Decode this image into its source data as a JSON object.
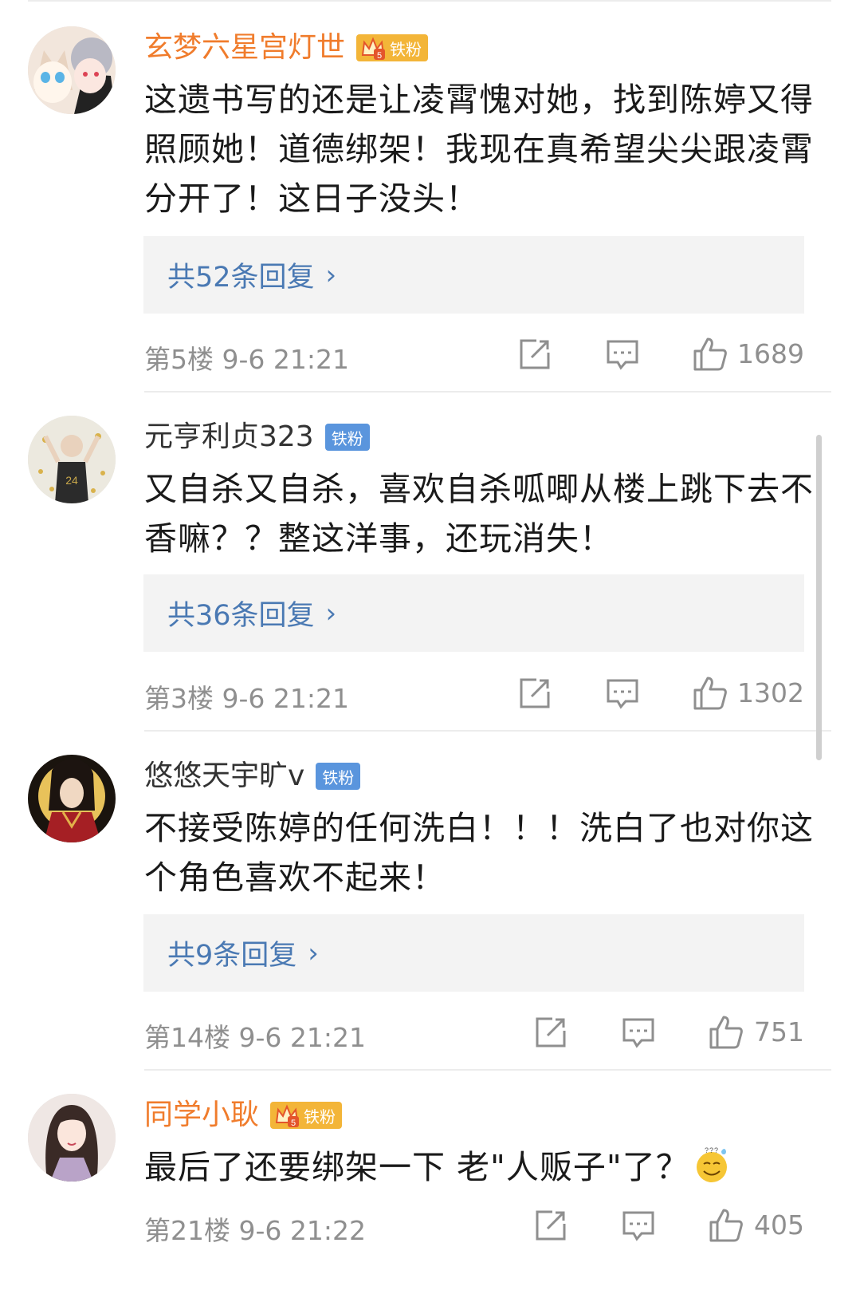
{
  "labels": {
    "reply_suffix": "条回复"
  },
  "colors": {
    "vip_name": "#f07c2c",
    "reply_link": "#4a79b3",
    "badge_blue": "#5a95dd",
    "badge_gold": "#f3b538"
  },
  "comments": [
    {
      "username": "玄梦六星宫灯世",
      "vip": true,
      "badge": "铁粉",
      "text": "这遗书写的还是让凌霄愧对她，找到陈婷又得照顾她！道德绑架！我现在真希望尖尖跟凌霄分开了！这日子没头！",
      "replies": "共52条回复",
      "floor": "第5楼",
      "time": "9-6 21:21",
      "likes": "1689"
    },
    {
      "username": "元亨利贞323",
      "vip": false,
      "badge": "铁粉",
      "text": "又自杀又自杀，喜欢自杀呱唧从楼上跳下去不香嘛？？整这洋事，还玩消失！",
      "replies": "共36条回复",
      "floor": "第3楼",
      "time": "9-6 21:21",
      "likes": "1302"
    },
    {
      "username": "悠悠天宇旷v",
      "vip": false,
      "badge": "铁粉",
      "text": "不接受陈婷的任何洗白！！！洗白了也对你这个角色喜欢不起来！",
      "replies": "共9条回复",
      "floor": "第14楼",
      "time": "9-6 21:21",
      "likes": "751"
    },
    {
      "username": "同学小耿",
      "vip": true,
      "badge": "铁粉",
      "text": "最后了还要绑架一下 老\"人贩子\"了？",
      "emoji": "sweat-smile-emoji",
      "floor": "第21楼",
      "time": "9-6 21:22",
      "likes": "405"
    }
  ]
}
